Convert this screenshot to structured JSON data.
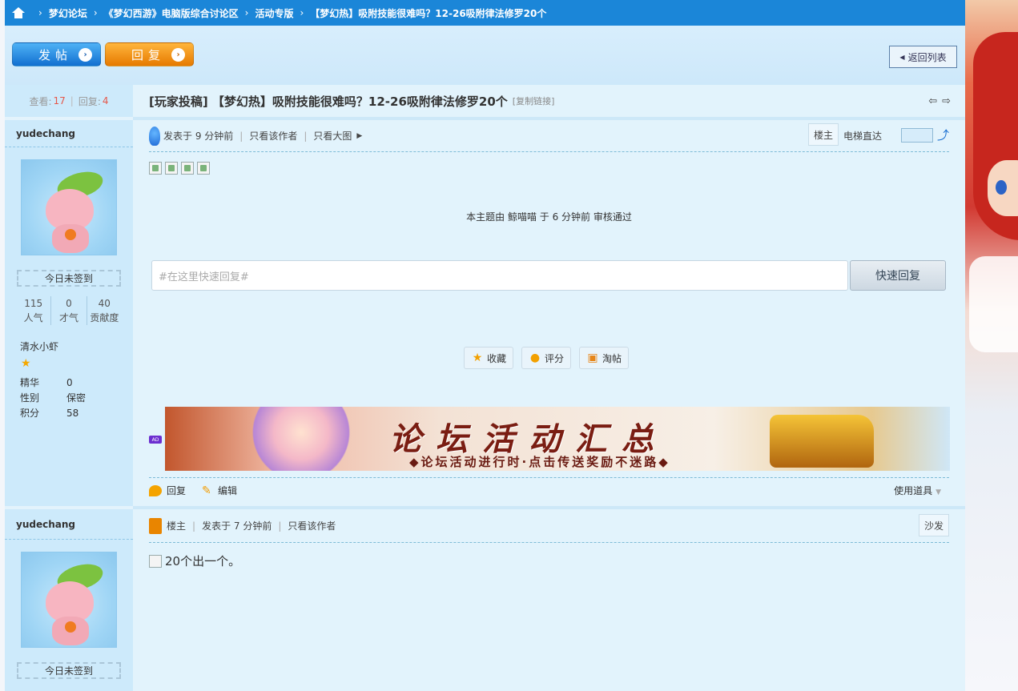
{
  "breadcrumb": [
    "梦幻论坛",
    "《梦幻西游》电脑版综合讨论区",
    "活动专版",
    "【梦幻热】吸附技能很难吗？12-26吸附律法修罗20个"
  ],
  "actions": {
    "post_label": "发帖",
    "reply_label": "回复",
    "back_label": "返回列表"
  },
  "thread": {
    "views_label": "查看:",
    "views": "17",
    "replies_label": "回复:",
    "replies": "4",
    "title": "[玩家投稿] 【梦幻热】吸附技能很难吗？12-26吸附律法修罗20个",
    "copy_link": "[复制链接]"
  },
  "user": {
    "name": "yudechang",
    "signin": "今日未签到",
    "counts": [
      {
        "value": "115",
        "label": "人气"
      },
      {
        "value": "0",
        "label": "才气"
      },
      {
        "value": "40",
        "label": "贡献度"
      }
    ],
    "group": "清水小虾",
    "info": [
      {
        "k": "精华",
        "v": "0"
      },
      {
        "k": "性别",
        "v": "保密"
      },
      {
        "k": "积分",
        "v": "58"
      }
    ]
  },
  "post1": {
    "posted": "发表于 9 分钟前",
    "only_author": "只看该作者",
    "only_big": "只看大图",
    "floor": "楼主",
    "elevator": "电梯直达",
    "audit": "本主题由 鲸喵喵 于 6 分钟前 审核通过",
    "quick_reply_placeholder": "#在这里快速回复#",
    "quick_reply_button": "快速回复",
    "tools": [
      "收藏",
      "评分",
      "淘帖"
    ],
    "ad_tag": "AD",
    "banner_title": "论坛活动汇总",
    "banner_sub": "◆论坛活动进行时·点击传送奖励不迷路◆",
    "reply": "回复",
    "edit": "编辑",
    "use_props": "使用道具"
  },
  "post2": {
    "author": "yudechang",
    "host_tag": "楼主",
    "posted": "发表于 7 分钟前",
    "only_author": "只看该作者",
    "floor": "沙发",
    "content": "20个出一个。",
    "signin": "今日未签到"
  },
  "colors": {
    "topbar": "#1b86d8",
    "page_bg": "#e3f3fc",
    "left_bg": "#cdeafb"
  }
}
